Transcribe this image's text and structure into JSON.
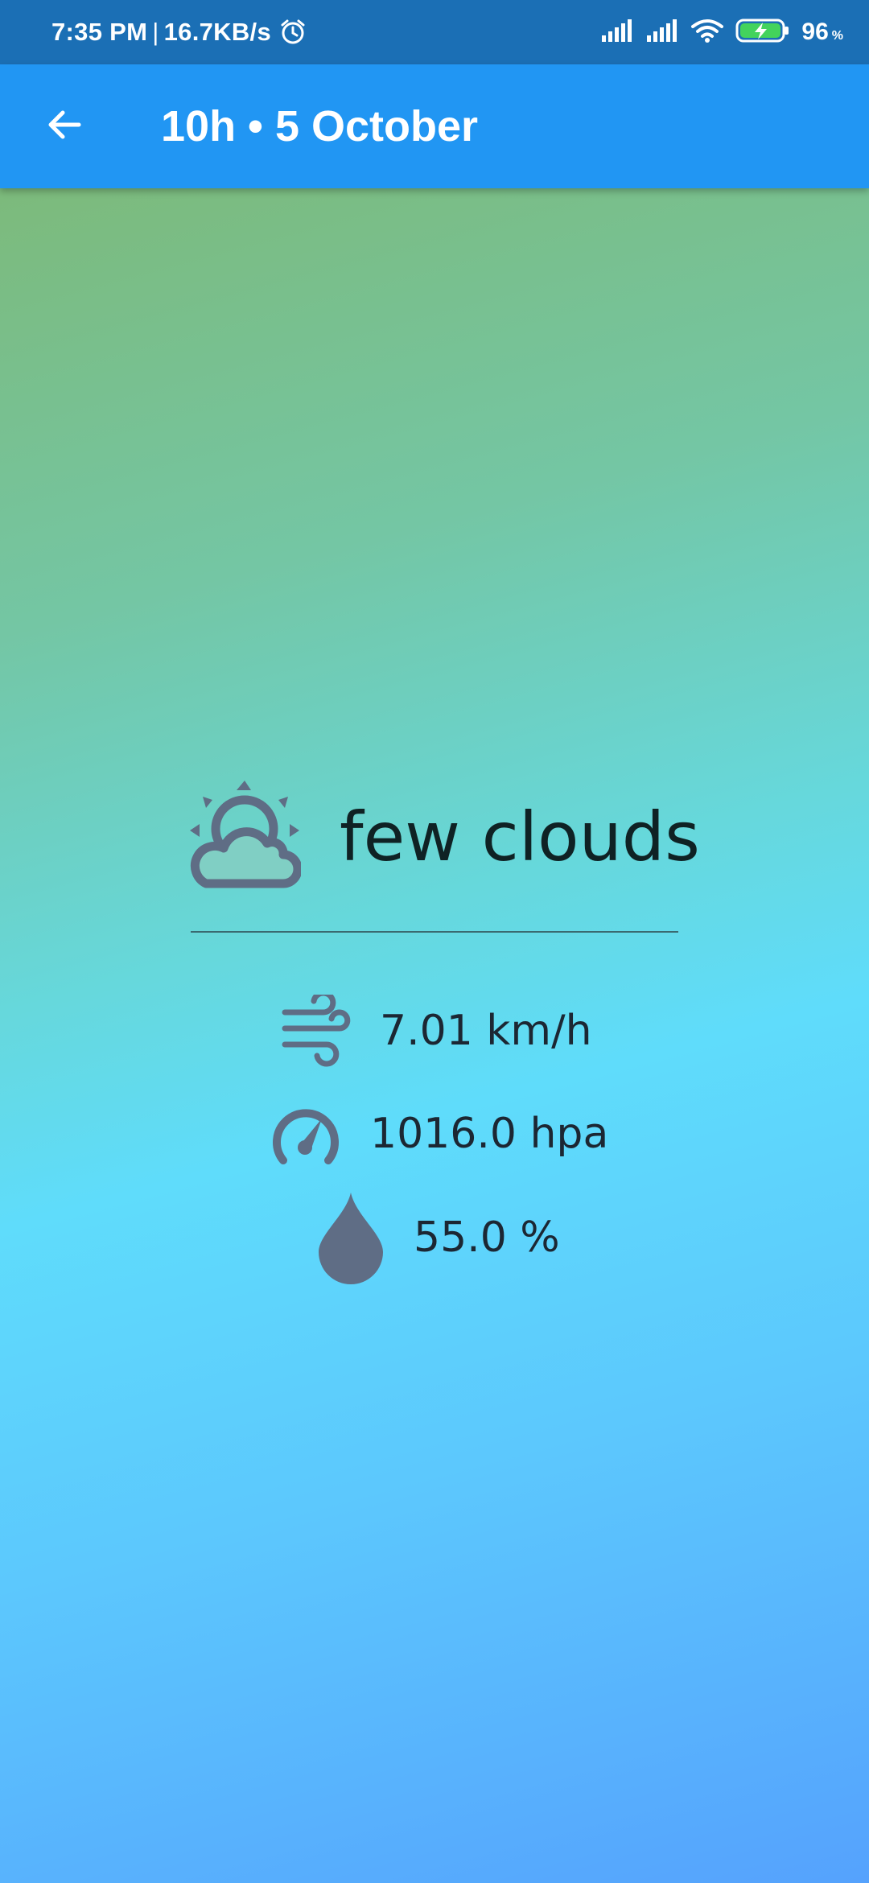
{
  "status_bar": {
    "time": "7:35 PM",
    "separator": "|",
    "network_speed": "16.7KB/s",
    "alarm_icon": "alarm-clock-icon",
    "signal_icons": [
      "signal-bars-icon",
      "signal-bars-icon"
    ],
    "wifi_icon": "wifi-icon",
    "battery_icon": "battery-charging-icon",
    "battery_level": "96",
    "battery_unit": "%"
  },
  "app_bar": {
    "back_icon": "arrow-left-icon",
    "title": "10h • 5 October"
  },
  "weather": {
    "condition_icon": "sun-behind-cloud-icon",
    "description": "few clouds"
  },
  "metrics": [
    {
      "icon": "wind-icon",
      "value": "7.01 km/h"
    },
    {
      "icon": "gauge-icon",
      "value": "1016.0 hpa"
    },
    {
      "icon": "droplet-icon",
      "value": "55.0 %"
    }
  ],
  "colors": {
    "status_bar": "#1b6fb5",
    "app_bar": "#2196f3",
    "icon_gray": "#5f6d85",
    "text_dark": "#1c2733",
    "gradient": [
      "#80b56a",
      "#74c6a4",
      "#66d8dc",
      "#5fdcfb",
      "#55a2fd"
    ]
  }
}
